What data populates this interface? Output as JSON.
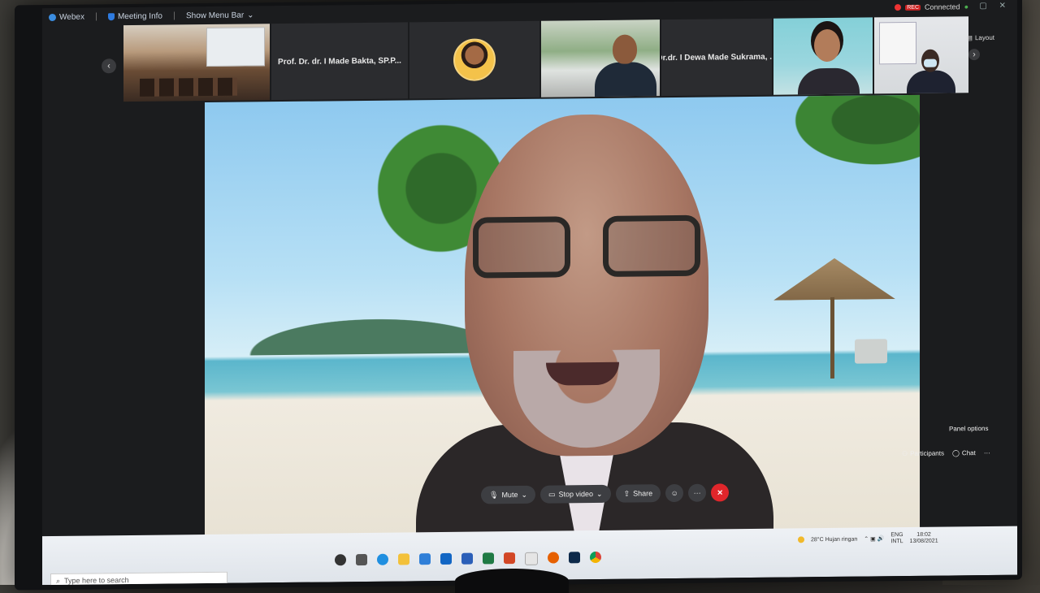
{
  "menubar": {
    "app": "Webex",
    "meeting_info": "Meeting Info",
    "show_menu_bar": "Show Menu Bar"
  },
  "status": {
    "rec_badge": "REC",
    "connected": "Connected"
  },
  "participants_strip": [
    {
      "label": ""
    },
    {
      "label": "Prof. Dr. dr. I Made Bakta, SP.P..."
    },
    {
      "label": ""
    },
    {
      "label": ""
    },
    {
      "label": "Dr.dr. I Dewa Made Sukrama, ..."
    },
    {
      "label": ""
    },
    {
      "label": ""
    }
  ],
  "layout_label": "Layout",
  "panel_options": "Panel options",
  "side_panel": {
    "participants": "Participants",
    "chat": "Chat"
  },
  "controls": {
    "mute": "Mute",
    "stop_video": "Stop video",
    "share": "Share",
    "end_symbol": "✕",
    "more": "···"
  },
  "taskbar": {
    "search_placeholder": "Type here to search",
    "weather": "28°C Hujan ringan",
    "lang_top": "ENG",
    "lang_bottom": "INTL",
    "time": "18:02",
    "date": "13/08/2021"
  },
  "colors": {
    "end_button": "#e0262b",
    "webex_blue": "#3b8de0"
  }
}
